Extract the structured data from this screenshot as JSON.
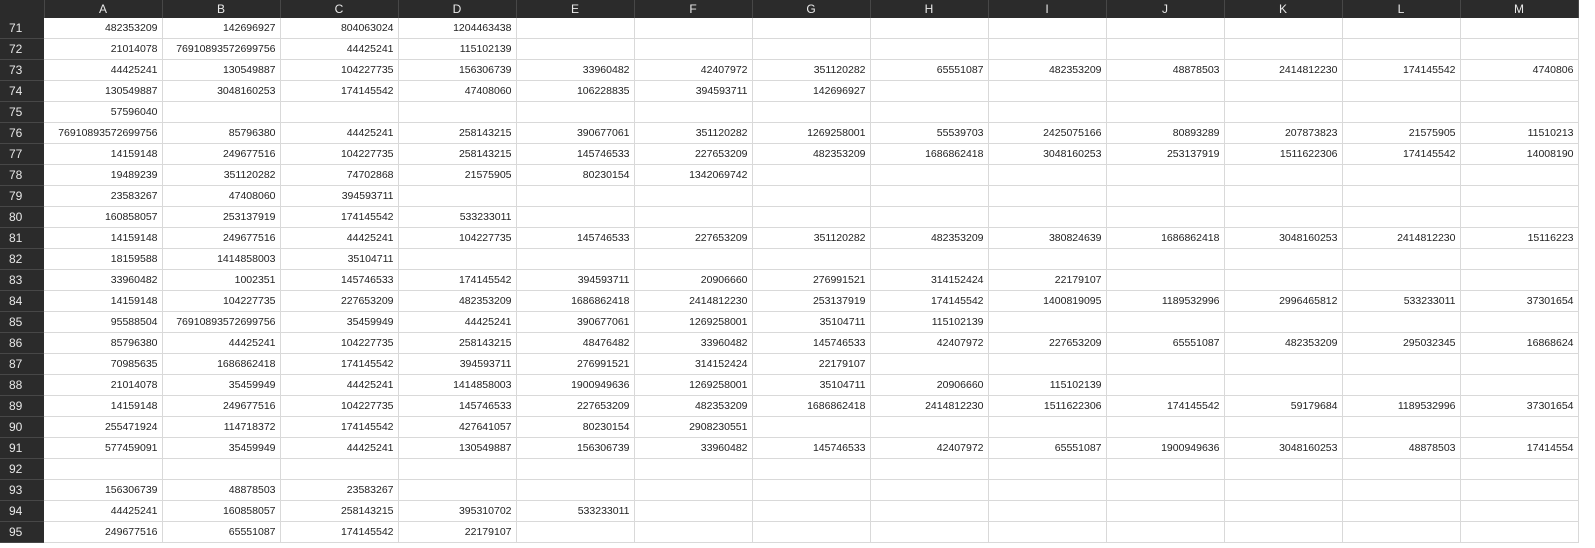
{
  "columns": [
    "A",
    "B",
    "C",
    "D",
    "E",
    "F",
    "G",
    "H",
    "I",
    "J",
    "K",
    "L",
    "M"
  ],
  "rows": [
    {
      "num": "71",
      "cells": [
        "482353209",
        "142696927",
        "804063024",
        "1204463438",
        "",
        "",
        "",
        "",
        "",
        "",
        "",
        "",
        ""
      ]
    },
    {
      "num": "72",
      "cells": [
        "21014078",
        "76910893572699756",
        "44425241",
        "115102139",
        "",
        "",
        "",
        "",
        "",
        "",
        "",
        "",
        ""
      ]
    },
    {
      "num": "73",
      "cells": [
        "44425241",
        "130549887",
        "104227735",
        "156306739",
        "33960482",
        "42407972",
        "351120282",
        "65551087",
        "482353209",
        "48878503",
        "2414812230",
        "174145542",
        "4740806"
      ]
    },
    {
      "num": "74",
      "cells": [
        "130549887",
        "3048160253",
        "174145542",
        "47408060",
        "106228835",
        "394593711",
        "142696927",
        "",
        "",
        "",
        "",
        "",
        ""
      ]
    },
    {
      "num": "75",
      "cells": [
        "57596040",
        "",
        "",
        "",
        "",
        "",
        "",
        "",
        "",
        "",
        "",
        "",
        ""
      ]
    },
    {
      "num": "76",
      "cells": [
        "76910893572699756",
        "85796380",
        "44425241",
        "258143215",
        "390677061",
        "351120282",
        "1269258001",
        "55539703",
        "2425075166",
        "80893289",
        "207873823",
        "21575905",
        "11510213"
      ]
    },
    {
      "num": "77",
      "cells": [
        "14159148",
        "249677516",
        "104227735",
        "258143215",
        "145746533",
        "227653209",
        "482353209",
        "1686862418",
        "3048160253",
        "253137919",
        "1511622306",
        "174145542",
        "14008190"
      ]
    },
    {
      "num": "78",
      "cells": [
        "19489239",
        "351120282",
        "74702868",
        "21575905",
        "80230154",
        "1342069742",
        "",
        "",
        "",
        "",
        "",
        "",
        ""
      ]
    },
    {
      "num": "79",
      "cells": [
        "23583267",
        "47408060",
        "394593711",
        "",
        "",
        "",
        "",
        "",
        "",
        "",
        "",
        "",
        ""
      ]
    },
    {
      "num": "80",
      "cells": [
        "160858057",
        "253137919",
        "174145542",
        "533233011",
        "",
        "",
        "",
        "",
        "",
        "",
        "",
        "",
        ""
      ]
    },
    {
      "num": "81",
      "cells": [
        "14159148",
        "249677516",
        "44425241",
        "104227735",
        "145746533",
        "227653209",
        "351120282",
        "482353209",
        "380824639",
        "1686862418",
        "3048160253",
        "2414812230",
        "15116223"
      ]
    },
    {
      "num": "82",
      "cells": [
        "18159588",
        "1414858003",
        "35104711",
        "",
        "",
        "",
        "",
        "",
        "",
        "",
        "",
        "",
        ""
      ]
    },
    {
      "num": "83",
      "cells": [
        "33960482",
        "1002351",
        "145746533",
        "174145542",
        "394593711",
        "20906660",
        "276991521",
        "314152424",
        "22179107",
        "",
        "",
        "",
        ""
      ]
    },
    {
      "num": "84",
      "cells": [
        "14159148",
        "104227735",
        "227653209",
        "482353209",
        "1686862418",
        "2414812230",
        "253137919",
        "174145542",
        "1400819095",
        "1189532996",
        "2996465812",
        "533233011",
        "37301654"
      ]
    },
    {
      "num": "85",
      "cells": [
        "95588504",
        "76910893572699756",
        "35459949",
        "44425241",
        "390677061",
        "1269258001",
        "35104711",
        "115102139",
        "",
        "",
        "",
        "",
        ""
      ]
    },
    {
      "num": "86",
      "cells": [
        "85796380",
        "44425241",
        "104227735",
        "258143215",
        "48476482",
        "33960482",
        "145746533",
        "42407972",
        "227653209",
        "65551087",
        "482353209",
        "295032345",
        "16868624"
      ]
    },
    {
      "num": "87",
      "cells": [
        "70985635",
        "1686862418",
        "174145542",
        "394593711",
        "276991521",
        "314152424",
        "22179107",
        "",
        "",
        "",
        "",
        "",
        ""
      ]
    },
    {
      "num": "88",
      "cells": [
        "21014078",
        "35459949",
        "44425241",
        "1414858003",
        "1900949636",
        "1269258001",
        "35104711",
        "20906660",
        "115102139",
        "",
        "",
        "",
        ""
      ]
    },
    {
      "num": "89",
      "cells": [
        "14159148",
        "249677516",
        "104227735",
        "145746533",
        "227653209",
        "482353209",
        "1686862418",
        "2414812230",
        "1511622306",
        "174145542",
        "59179684",
        "1189532996",
        "37301654"
      ]
    },
    {
      "num": "90",
      "cells": [
        "255471924",
        "114718372",
        "174145542",
        "427641057",
        "80230154",
        "2908230551",
        "",
        "",
        "",
        "",
        "",
        "",
        ""
      ]
    },
    {
      "num": "91",
      "cells": [
        "577459091",
        "35459949",
        "44425241",
        "130549887",
        "156306739",
        "33960482",
        "145746533",
        "42407972",
        "65551087",
        "1900949636",
        "3048160253",
        "48878503",
        "17414554"
      ]
    },
    {
      "num": "92",
      "cells": [
        "",
        "",
        "",
        "",
        "",
        "",
        "",
        "",
        "",
        "",
        "",
        "",
        ""
      ]
    },
    {
      "num": "93",
      "cells": [
        "156306739",
        "48878503",
        "23583267",
        "",
        "",
        "",
        "",
        "",
        "",
        "",
        "",
        "",
        ""
      ]
    },
    {
      "num": "94",
      "cells": [
        "44425241",
        "160858057",
        "258143215",
        "395310702",
        "533233011",
        "",
        "",
        "",
        "",
        "",
        "",
        "",
        ""
      ]
    },
    {
      "num": "95",
      "cells": [
        "249677516",
        "65551087",
        "174145542",
        "22179107",
        "",
        "",
        "",
        "",
        "",
        "",
        "",
        "",
        ""
      ]
    }
  ]
}
